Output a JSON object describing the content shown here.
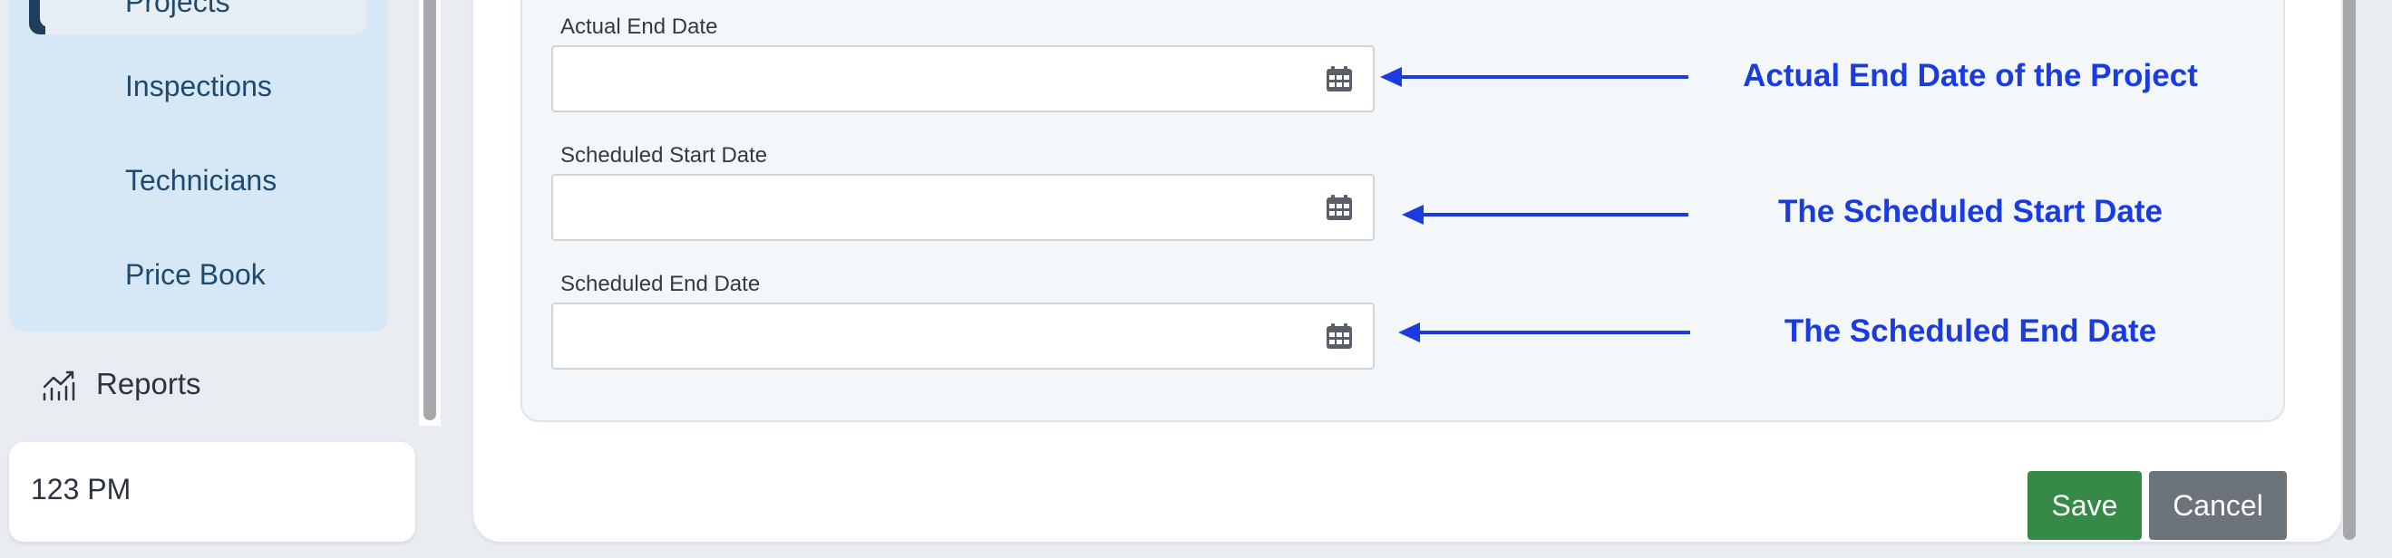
{
  "sidebar": {
    "active_item": "Projects",
    "items": [
      {
        "label": "Inspections"
      },
      {
        "label": "Technicians"
      },
      {
        "label": "Price Book"
      }
    ],
    "reports": {
      "label": "Reports",
      "icon": "chart-line-icon"
    },
    "user": {
      "name": "123 PM"
    }
  },
  "form": {
    "fields": [
      {
        "label": "Actual End Date",
        "value": "",
        "icon": "calendar-icon"
      },
      {
        "label": "Scheduled Start Date",
        "value": "",
        "icon": "calendar-icon"
      },
      {
        "label": "Scheduled End Date",
        "value": "",
        "icon": "calendar-icon"
      }
    ],
    "annotations": [
      {
        "text": "Actual End Date of the Project"
      },
      {
        "text": "The Scheduled Start Date"
      },
      {
        "text": "The Scheduled End Date"
      }
    ],
    "save_label": "Save",
    "cancel_label": "Cancel"
  },
  "colors": {
    "annotation": "#1a3be0",
    "save": "#348a46",
    "cancel": "#6c737b",
    "submenu_bg": "#d6e8f5",
    "nav_text": "#1f4a70"
  }
}
